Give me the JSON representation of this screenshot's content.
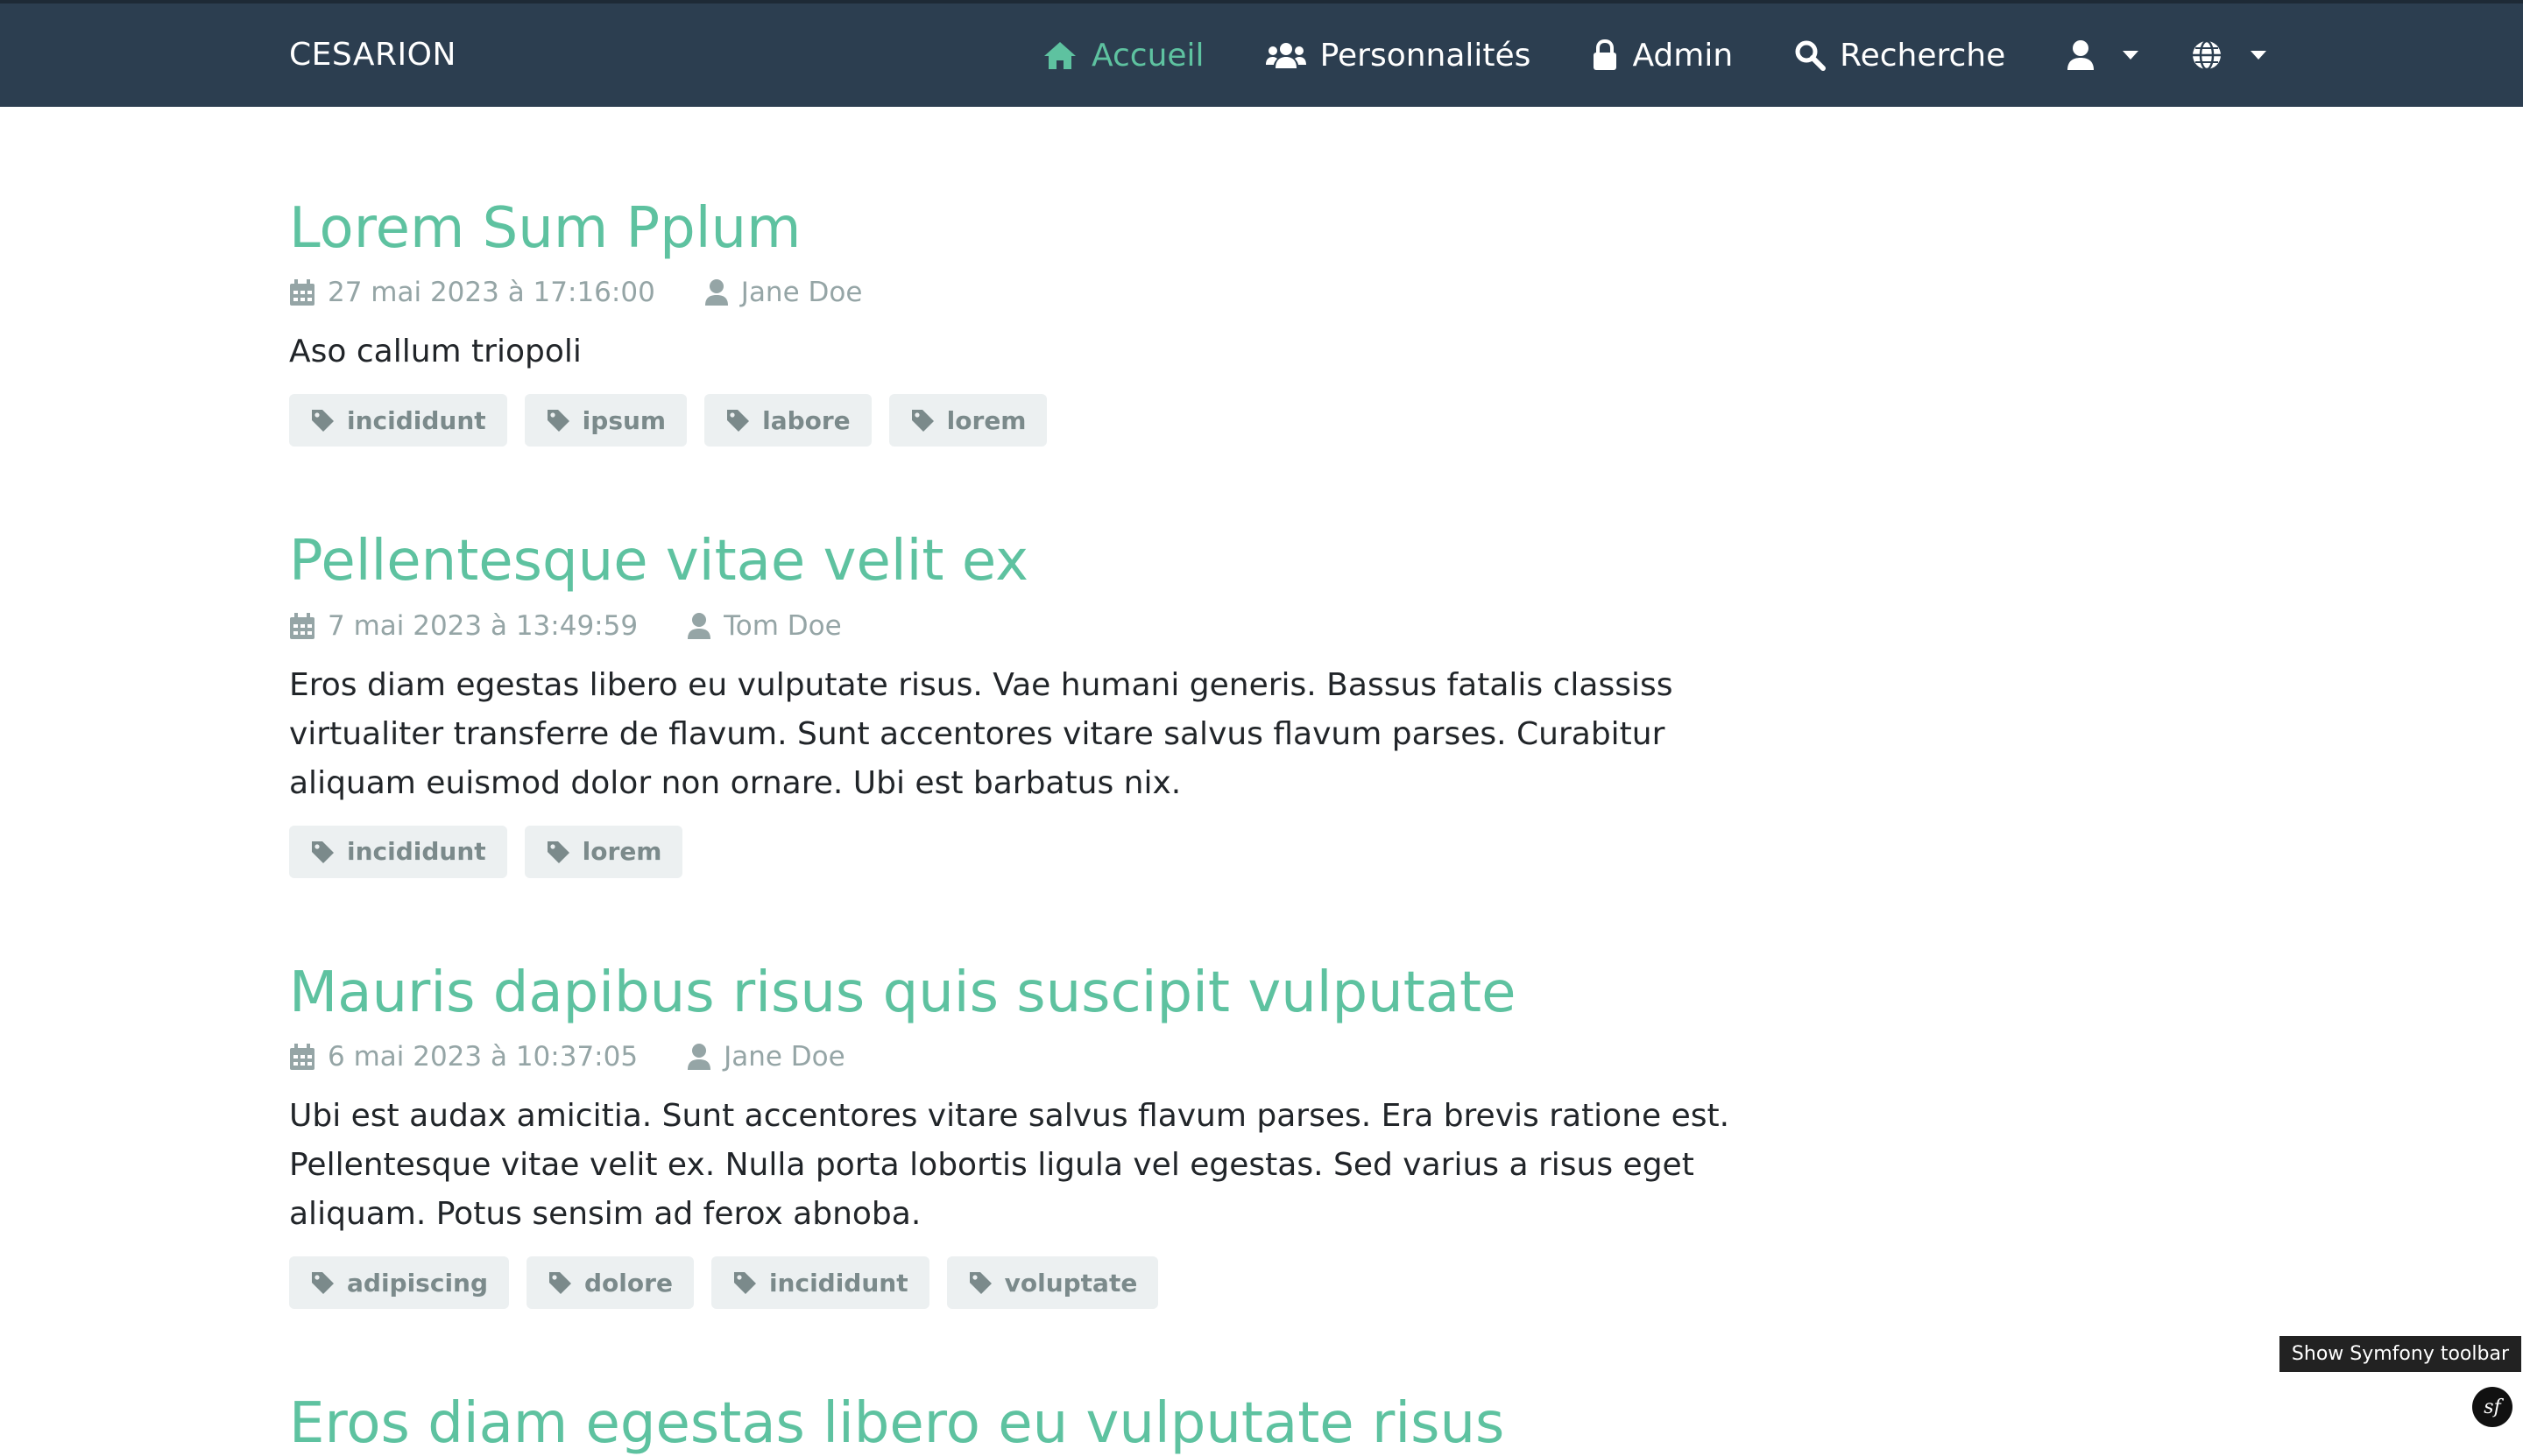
{
  "brand": "CESARION",
  "nav": {
    "home": "Accueil",
    "personalities": "Personnalités",
    "admin": "Admin",
    "search": "Recherche"
  },
  "posts": [
    {
      "title": "Lorem Sum Pplum",
      "date": "27 mai 2023 à 17:16:00",
      "author": "Jane Doe",
      "summary": "Aso callum triopoli",
      "tags": [
        "incididunt",
        "ipsum",
        "labore",
        "lorem"
      ]
    },
    {
      "title": "Pellentesque vitae velit ex",
      "date": "7 mai 2023 à 13:49:59",
      "author": "Tom Doe",
      "summary": "Eros diam egestas libero eu vulputate risus. Vae humani generis. Bassus fatalis classiss virtualiter transferre de flavum. Sunt accentores vitare salvus flavum parses. Curabitur aliquam euismod dolor non ornare. Ubi est barbatus nix.",
      "tags": [
        "incididunt",
        "lorem"
      ]
    },
    {
      "title": "Mauris dapibus risus quis suscipit vulputate",
      "date": "6 mai 2023 à 10:37:05",
      "author": "Jane Doe",
      "summary": "Ubi est audax amicitia. Sunt accentores vitare salvus flavum parses. Era brevis ratione est. Pellentesque vitae velit ex. Nulla porta lobortis ligula vel egestas. Sed varius a risus eget aliquam. Potus sensim ad ferox abnoba.",
      "tags": [
        "adipiscing",
        "dolore",
        "incididunt",
        "voluptate"
      ]
    },
    {
      "title": "Eros diam egestas libero eu vulputate risus"
    }
  ],
  "symfony_toolbar": "Show Symfony toolbar",
  "symfony_logo": "sf",
  "colors": {
    "navbar": "#2c3e50",
    "accent": "#5ec2a0",
    "muted": "#95a5a6",
    "tag_bg": "#ecf0f1"
  }
}
